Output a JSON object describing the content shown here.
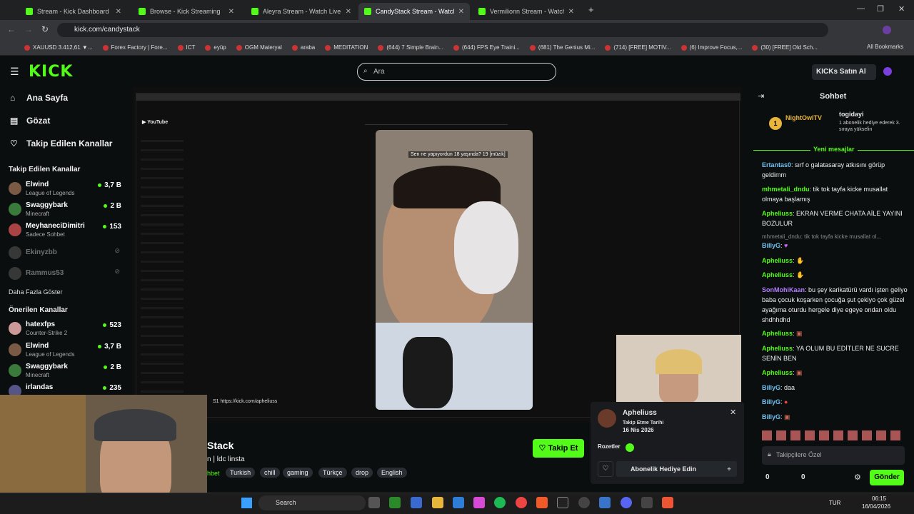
{
  "tabs": [
    {
      "label": "Stream - Kick Dashboard"
    },
    {
      "label": "Browse - Kick Streaming"
    },
    {
      "label": "Aleyra Stream - Watch Live on"
    },
    {
      "label": "CandyStack Stream - Watch Liv"
    },
    {
      "label": "Vermilionn Stream - Watch Live"
    }
  ],
  "address": "kick.com/candystack",
  "bookmarks": [
    "XAUUSD 3.412,61 ▼...",
    "Forex Factory | Fore...",
    "ICT",
    "eyüp",
    "OGM Materyal",
    "araba",
    "MEDITATION",
    "(644) 7 Simple Brain...",
    "(644) FPS Eye Traini...",
    "(681) The Genius Mi...",
    "(714) [FREE] MOTIV...",
    "(6) Improve Focus,...",
    "(30) [FREE] Old Sch..."
  ],
  "all_bookmarks": "All Bookmarks",
  "header": {
    "logo": "KICK",
    "search_placeholder": "Ara",
    "buy_kicks": "KICKs Satın Al"
  },
  "nav": {
    "home": "Ana Sayfa",
    "browse": "Gözat",
    "following": "Takip Edilen Kanallar"
  },
  "followed_title": "Takip Edilen Kanallar",
  "followed": [
    {
      "name": "Elwind",
      "game": "League of Legends",
      "viewers": "3,7 B"
    },
    {
      "name": "Swaggybark",
      "game": "Minecraft",
      "viewers": "2 B"
    },
    {
      "name": "MeyhaneciDimitri",
      "game": "Sadece Sohbet",
      "viewers": "153"
    },
    {
      "name": "Ekinyzbb",
      "game": "",
      "viewers": ""
    },
    {
      "name": "Rammus53",
      "game": "",
      "viewers": ""
    }
  ],
  "show_more": "Daha Fazla Göster",
  "recommended_title": "Önerilen Kanallar",
  "recommended": [
    {
      "name": "hatexfps",
      "game": "Counter-Strike 2",
      "viewers": "523"
    },
    {
      "name": "Elwind",
      "game": "League of Legends",
      "viewers": "3,7 B"
    },
    {
      "name": "Swaggybark",
      "game": "Minecraft",
      "viewers": "2 B"
    },
    {
      "name": "irlandas",
      "game": "",
      "viewers": "235"
    }
  ],
  "video": {
    "caption": "Sen ne yapıyordun 18 yaşında? 19 [müzik]",
    "overlay_url": "S1 https://kick.com/apheliuss"
  },
  "stream": {
    "name": "Stack",
    "title": "n | ldc linsta",
    "category": "hbet"
  },
  "tags": [
    "Turkish",
    "chill",
    "gaming",
    "Türkçe",
    "drop",
    "English"
  ],
  "follow_button": "Takip Et",
  "card": {
    "user": "Apheliuss",
    "follow_date_label": "Takip Etme Tarihi",
    "follow_date": "16 Nis 2026",
    "badges_label": "Rozetler",
    "gift_button": "Abonelik Hediye Edin"
  },
  "chat": {
    "title": "Sohbet",
    "top_user": "NightOwlTV",
    "top_rank": "1",
    "gifter": "togidayi",
    "gifter_note": "1 abonelik hediye ederek 3. sıraya yükselin",
    "new_messages": "Yeni mesajlar",
    "messages": [
      {
        "user": "Ertantas0",
        "text": "sırf o galatasaray atkısını görüp geldimm",
        "color": "#6ec1f0"
      },
      {
        "user": "mhmetali_dndu",
        "text": "tik tok tayfa kicke musallat olmaya başlamış",
        "color": "#53fc18"
      },
      {
        "user": "Apheliuss",
        "text": "EKRAN VERME CHATA AİLE YAYINI BOZULUR",
        "color": "#53fc18"
      },
      {
        "user": "BillyG",
        "text": "",
        "color": "#6ec1f0"
      },
      {
        "user": "Apheliuss",
        "text": "",
        "color": "#53fc18"
      },
      {
        "user": "Apheliuss",
        "text": "",
        "color": "#53fc18"
      },
      {
        "user": "SonMohiKaan",
        "text": "bu şey karikatürü vardı işten geliyo baba çocuk koşarken çocuğa şut çekiyo çok güzel ayağıma oturdu hergele diye egeye ondan oldu shdhhdhd",
        "color": "#b27cff"
      },
      {
        "user": "Apheliuss",
        "text": "",
        "color": "#53fc18"
      },
      {
        "user": "Apheliuss",
        "text": "YA OLUM BU EDİTLER NE SUCRE SENİN BEN",
        "color": "#53fc18"
      },
      {
        "user": "Apheliuss",
        "text": "",
        "color": "#53fc18"
      },
      {
        "user": "BillyG",
        "text": "daa",
        "color": "#6ec1f0"
      },
      {
        "user": "BillyG",
        "text": "",
        "color": "#6ec1f0"
      },
      {
        "user": "BillyG",
        "text": "",
        "color": "#6ec1f0"
      }
    ],
    "reply_preview": "mhmetali_dndu: tik tok tayfa kicke musallat ol...",
    "input_placeholder": "Takipçilere Özel",
    "count_a": "0",
    "count_b": "0",
    "send": "Gönder"
  },
  "taskbar": {
    "search": "Search",
    "lang": "TUR",
    "time": "06:15",
    "date": "16/04/2026"
  },
  "accent": "#53fc18"
}
